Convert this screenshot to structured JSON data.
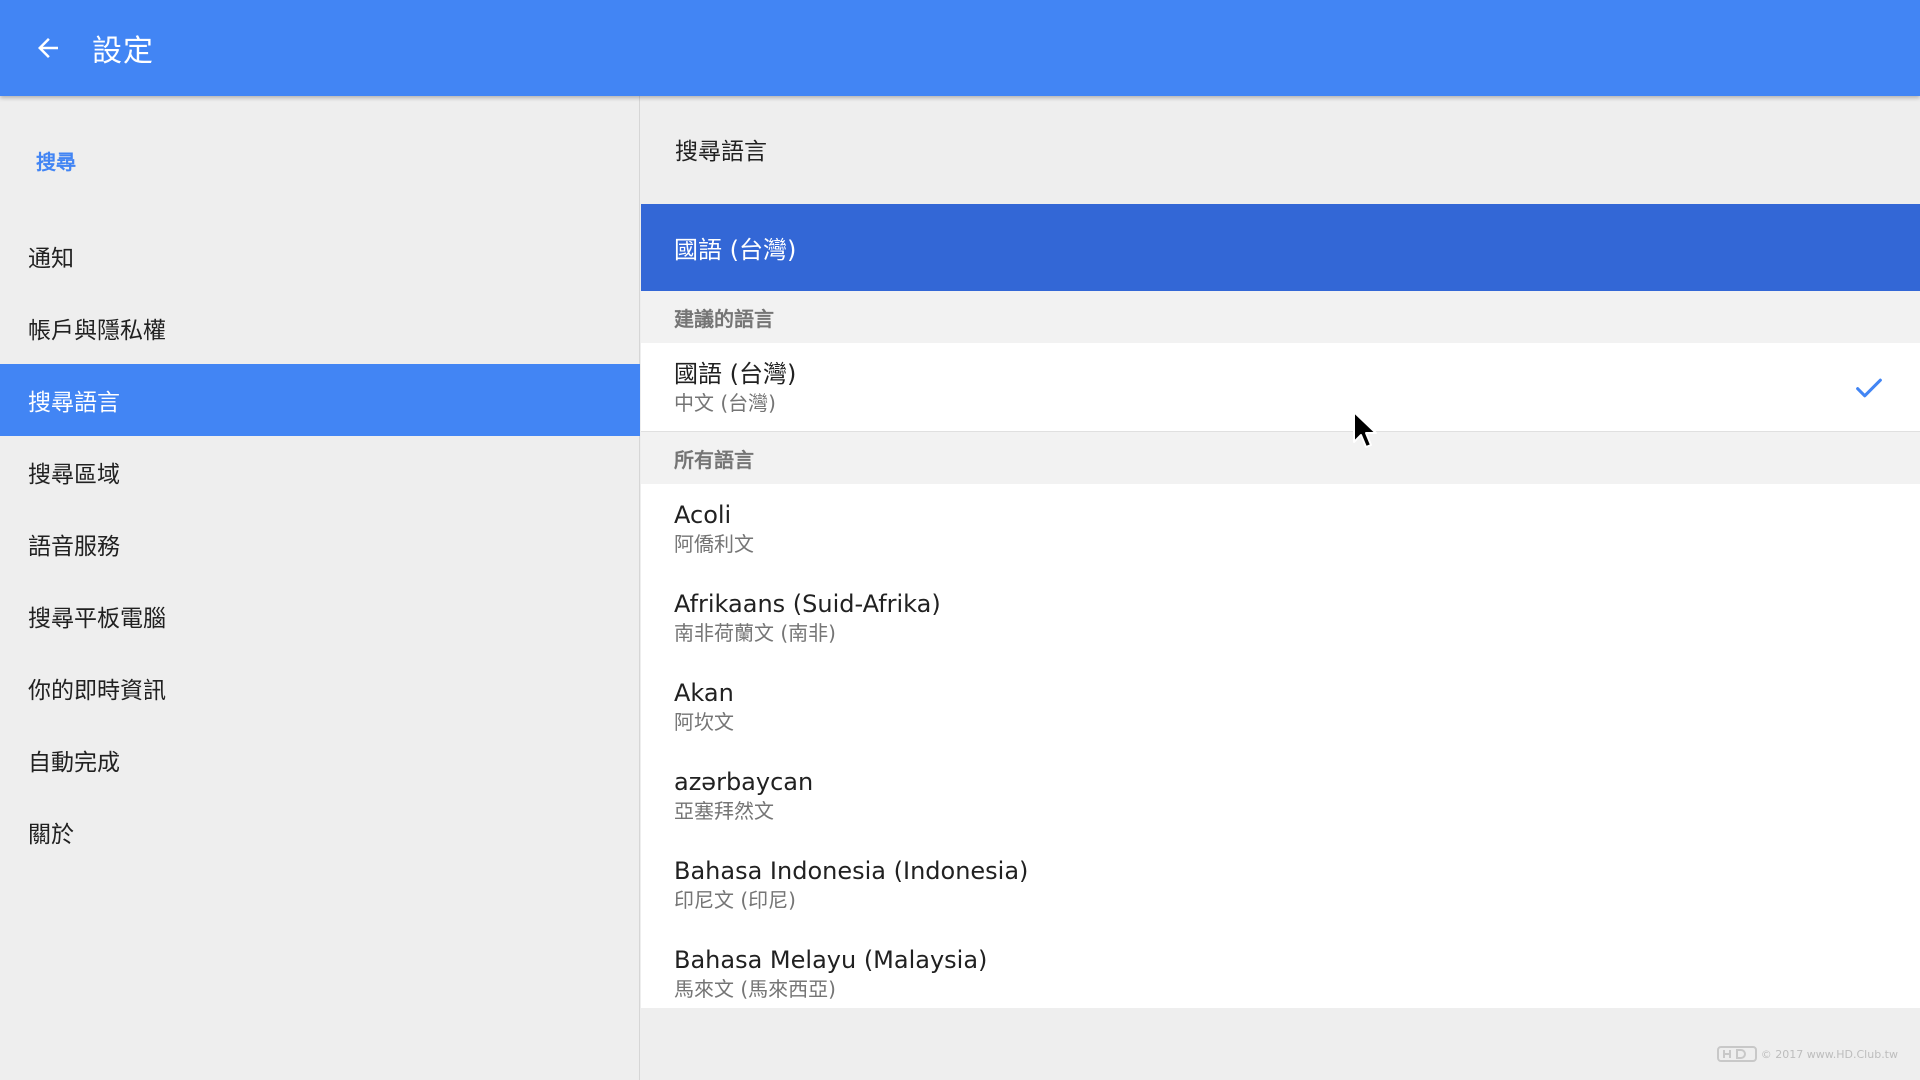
{
  "header": {
    "title": "設定",
    "back_icon": "arrow-left-icon"
  },
  "colors": {
    "primary": "#4285f4",
    "selected_banner": "#3367d6",
    "check": "#4285f4"
  },
  "sidebar": {
    "section_label": "搜尋",
    "items": [
      {
        "label": "通知"
      },
      {
        "label": "帳戶與隱私權"
      },
      {
        "label": "搜尋語言",
        "active": true
      },
      {
        "label": "搜尋區域"
      },
      {
        "label": "語音服務"
      },
      {
        "label": "搜尋平板電腦"
      },
      {
        "label": "你的即時資訊"
      },
      {
        "label": "自動完成"
      },
      {
        "label": "關於"
      }
    ]
  },
  "main": {
    "title": "搜尋語言",
    "selected_language": "國語 (台灣)",
    "suggested_header": "建議的語言",
    "suggested": {
      "name": "國語 (台灣)",
      "sub": "中文 (台灣)",
      "checked": true
    },
    "all_header": "所有語言",
    "languages": [
      {
        "name": "Acoli",
        "sub": "阿僑利文"
      },
      {
        "name": "Afrikaans (Suid-Afrika)",
        "sub": "南非荷蘭文 (南非)"
      },
      {
        "name": "Akan",
        "sub": "阿坎文"
      },
      {
        "name": "azərbaycan",
        "sub": "亞塞拜然文"
      },
      {
        "name": "Bahasa Indonesia (Indonesia)",
        "sub": "印尼文 (印尼)"
      },
      {
        "name": "Bahasa Melayu (Malaysia)",
        "sub": "馬來文 (馬來西亞)"
      }
    ]
  },
  "watermark": {
    "text": "© 2017 www.HD.Club.tw"
  }
}
